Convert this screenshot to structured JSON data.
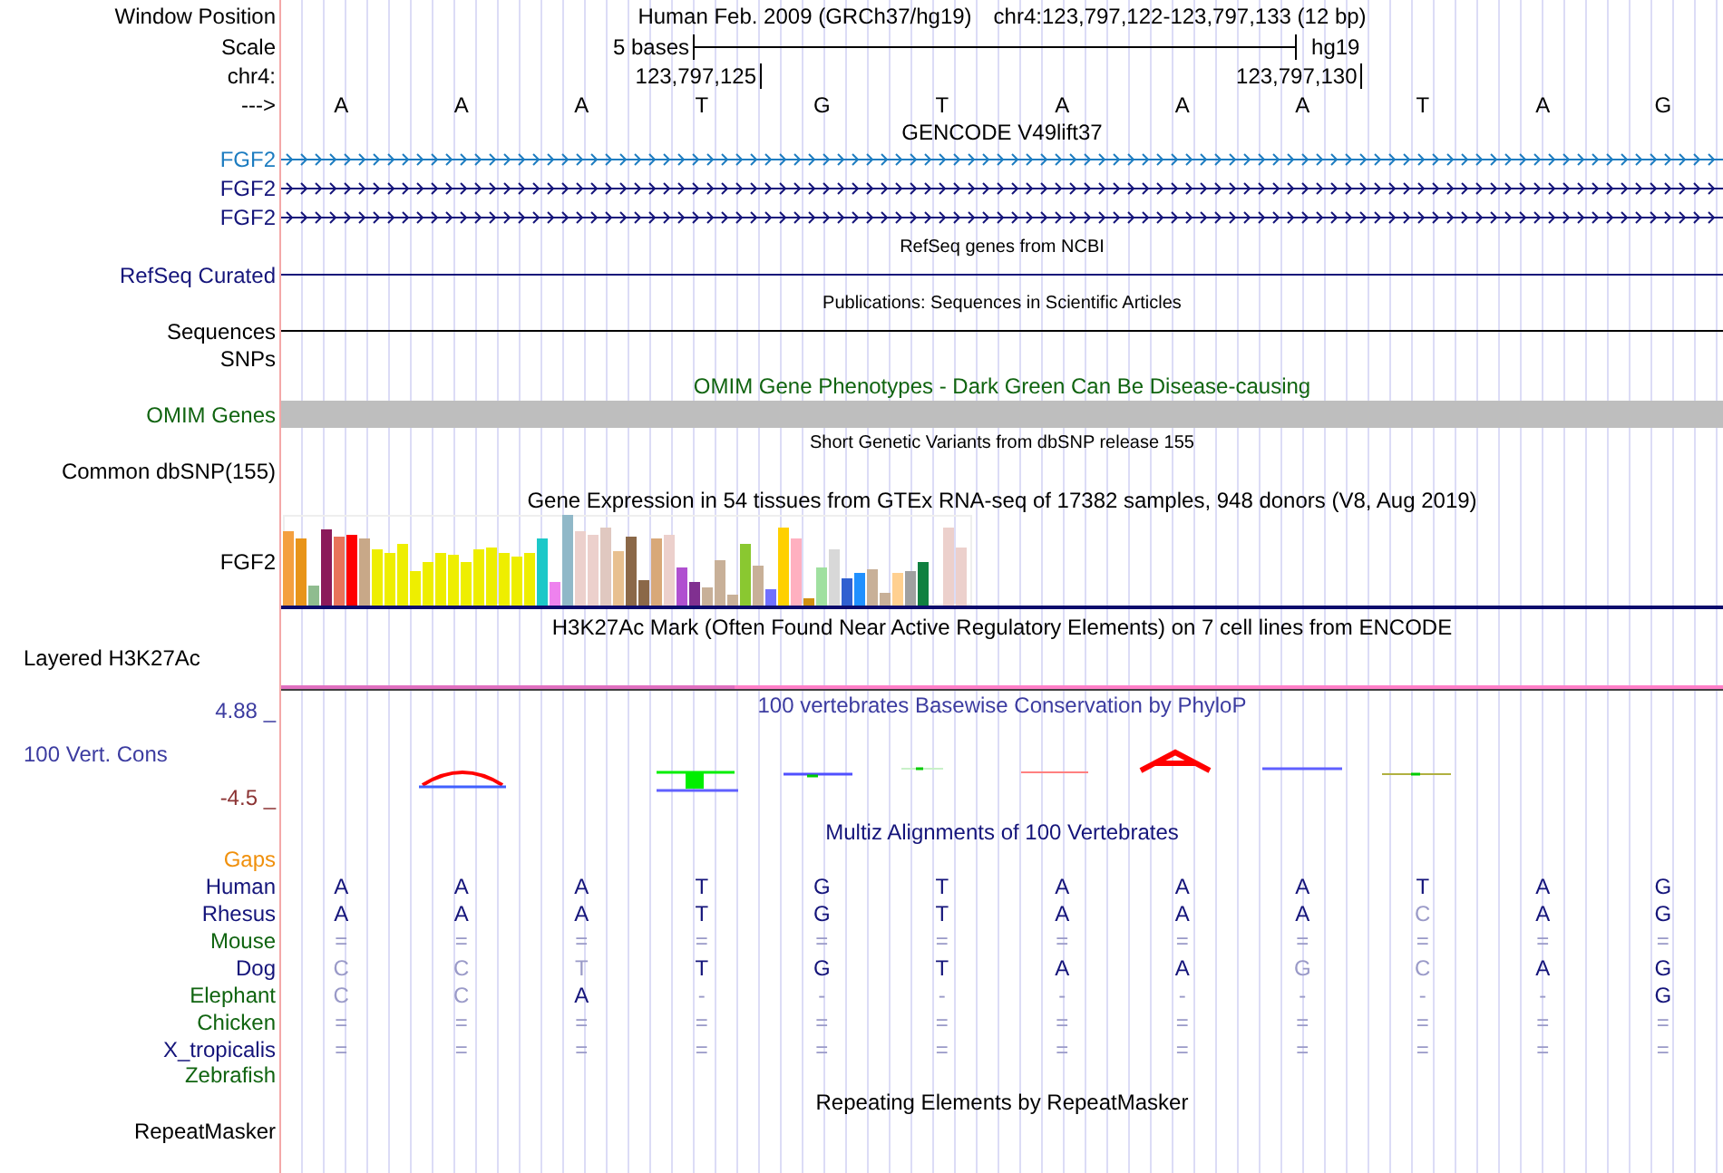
{
  "position": {
    "label": "Window Position",
    "assembly": "Human Feb. 2009 (GRCh37/hg19)",
    "range": "chr4:123,797,122-123,797,133 (12 bp)"
  },
  "scale": {
    "label": "Scale",
    "span": "5 bases",
    "assembly": "hg19"
  },
  "coordinates": {
    "label": "chr4:",
    "ticks": [
      "123,797,125",
      "123,797,130"
    ]
  },
  "sequence": {
    "label": "--->",
    "bases": [
      "A",
      "A",
      "A",
      "T",
      "G",
      "T",
      "A",
      "A",
      "A",
      "T",
      "A",
      "G"
    ]
  },
  "tracks": [
    {
      "kind": "genes",
      "title": "GENCODE V49lift37",
      "rows": [
        {
          "label": "FGF2",
          "color": "#1c7cc0"
        },
        {
          "label": "FGF2",
          "color": "#14147a"
        },
        {
          "label": "FGF2",
          "color": "#14147a"
        }
      ]
    },
    {
      "kind": "line",
      "title": "RefSeq genes from NCBI",
      "small_title": true,
      "label": "RefSeq Curated",
      "color": "#14147a"
    },
    {
      "kind": "line",
      "title": "Publications: Sequences in Scientific Articles",
      "small_title": true,
      "label": "Sequences",
      "color": "#000000"
    },
    {
      "kind": "label",
      "label": "SNPs",
      "color": "#000000"
    },
    {
      "kind": "block",
      "title": {
        "text": "OMIM Gene Phenotypes - Dark Green Can Be Disease-causing",
        "color": "#106410"
      },
      "label": "OMIM Genes",
      "color": "#106410"
    },
    {
      "kind": "empty",
      "title": "Short Genetic Variants from dbSNP release 155",
      "small_title": true,
      "label": "Common dbSNP(155)",
      "color": "#000000"
    },
    {
      "kind": "expression",
      "title": "Gene Expression in 54 tissues from GTEx RNA-seq of 17382 samples, 948 donors (V8, Aug 2019)",
      "label": "FGF2",
      "color": "#000000"
    },
    {
      "kind": "layered",
      "title": "H3K27Ac Mark (Often Found Near Active Regulatory Elements) on 7 cell lines from ENCODE",
      "label": "Layered H3K27Ac",
      "color": "#000000"
    },
    {
      "kind": "conservation",
      "title": {
        "text": "100 vertebrates Basewise Conservation by PhyloP",
        "color": "#3c3ca0"
      },
      "label": "100 Vert. Cons",
      "color": "#3c3ca0",
      "scale": [
        {
          "text": "4.88 _",
          "color": "#3c3ca0"
        },
        {
          "text": "-4.5 _",
          "color": "#8c3434"
        }
      ]
    },
    {
      "kind": "alignment",
      "title": {
        "text": "Multiz Alignments of 100 Vertebrates",
        "color": "#14147a"
      },
      "rows": [
        {
          "name": "Gaps",
          "color": "#f0900c"
        },
        {
          "name": "Human",
          "color": "#14147a",
          "cells": [
            {
              "base": "A",
              "faded": false
            },
            {
              "base": "A",
              "faded": false
            },
            {
              "base": "A",
              "faded": false
            },
            {
              "base": "T",
              "faded": false
            },
            {
              "base": "G",
              "faded": false
            },
            {
              "base": "T",
              "faded": false
            },
            {
              "base": "A",
              "faded": false
            },
            {
              "base": "A",
              "faded": false
            },
            {
              "base": "A",
              "faded": false
            },
            {
              "base": "T",
              "faded": false
            },
            {
              "base": "A",
              "faded": false
            },
            {
              "base": "G",
              "faded": false
            }
          ]
        },
        {
          "name": "Rhesus",
          "color": "#14147a",
          "cells": [
            {
              "base": "A",
              "faded": false
            },
            {
              "base": "A",
              "faded": false
            },
            {
              "base": "A",
              "faded": false
            },
            {
              "base": "T",
              "faded": false
            },
            {
              "base": "G",
              "faded": false
            },
            {
              "base": "T",
              "faded": false
            },
            {
              "base": "A",
              "faded": false
            },
            {
              "base": "A",
              "faded": false
            },
            {
              "base": "A",
              "faded": false
            },
            {
              "base": "C",
              "faded": true
            },
            {
              "base": "A",
              "faded": false
            },
            {
              "base": "G",
              "faded": false
            }
          ]
        },
        {
          "name": "Mouse",
          "color": "#106410",
          "cells": [
            {
              "base": "=",
              "faded": true
            },
            {
              "base": "=",
              "faded": true
            },
            {
              "base": "=",
              "faded": true
            },
            {
              "base": "=",
              "faded": true
            },
            {
              "base": "=",
              "faded": true
            },
            {
              "base": "=",
              "faded": true
            },
            {
              "base": "=",
              "faded": true
            },
            {
              "base": "=",
              "faded": true
            },
            {
              "base": "=",
              "faded": true
            },
            {
              "base": "=",
              "faded": true
            },
            {
              "base": "=",
              "faded": true
            },
            {
              "base": "=",
              "faded": true
            }
          ]
        },
        {
          "name": "Dog",
          "color": "#14147a",
          "cells": [
            {
              "base": "C",
              "faded": true
            },
            {
              "base": "C",
              "faded": true
            },
            {
              "base": "T",
              "faded": true
            },
            {
              "base": "T",
              "faded": false
            },
            {
              "base": "G",
              "faded": false
            },
            {
              "base": "T",
              "faded": false
            },
            {
              "base": "A",
              "faded": false
            },
            {
              "base": "A",
              "faded": false
            },
            {
              "base": "G",
              "faded": true
            },
            {
              "base": "C",
              "faded": true
            },
            {
              "base": "A",
              "faded": false
            },
            {
              "base": "G",
              "faded": false
            }
          ]
        },
        {
          "name": "Elephant",
          "color": "#106410",
          "cells": [
            {
              "base": "C",
              "faded": true
            },
            {
              "base": "C",
              "faded": true
            },
            {
              "base": "A",
              "faded": false
            },
            {
              "base": "-",
              "faded": true
            },
            {
              "base": "-",
              "faded": true
            },
            {
              "base": "-",
              "faded": true
            },
            {
              "base": "-",
              "faded": true
            },
            {
              "base": "-",
              "faded": true
            },
            {
              "base": "-",
              "faded": true
            },
            {
              "base": "-",
              "faded": true
            },
            {
              "base": "-",
              "faded": true
            },
            {
              "base": "G",
              "faded": false
            }
          ]
        },
        {
          "name": "Chicken",
          "color": "#106410",
          "cells": [
            {
              "base": "=",
              "faded": true
            },
            {
              "base": "=",
              "faded": true
            },
            {
              "base": "=",
              "faded": true
            },
            {
              "base": "=",
              "faded": true
            },
            {
              "base": "=",
              "faded": true
            },
            {
              "base": "=",
              "faded": true
            },
            {
              "base": "=",
              "faded": true
            },
            {
              "base": "=",
              "faded": true
            },
            {
              "base": "=",
              "faded": true
            },
            {
              "base": "=",
              "faded": true
            },
            {
              "base": "=",
              "faded": true
            },
            {
              "base": "=",
              "faded": true
            }
          ]
        },
        {
          "name": "X_tropicalis",
          "color": "#14147a",
          "cells": [
            {
              "base": "=",
              "faded": true
            },
            {
              "base": "=",
              "faded": true
            },
            {
              "base": "=",
              "faded": true
            },
            {
              "base": "=",
              "faded": true
            },
            {
              "base": "=",
              "faded": true
            },
            {
              "base": "=",
              "faded": true
            },
            {
              "base": "=",
              "faded": true
            },
            {
              "base": "=",
              "faded": true
            },
            {
              "base": "=",
              "faded": true
            },
            {
              "base": "=",
              "faded": true
            },
            {
              "base": "=",
              "faded": true
            },
            {
              "base": "=",
              "faded": true
            }
          ]
        },
        {
          "name": "Zebrafish",
          "color": "#106410"
        }
      ]
    },
    {
      "kind": "repeats",
      "title": "Repeating Elements by RepeatMasker",
      "label": "RepeatMasker",
      "color": "#000000"
    }
  ]
}
